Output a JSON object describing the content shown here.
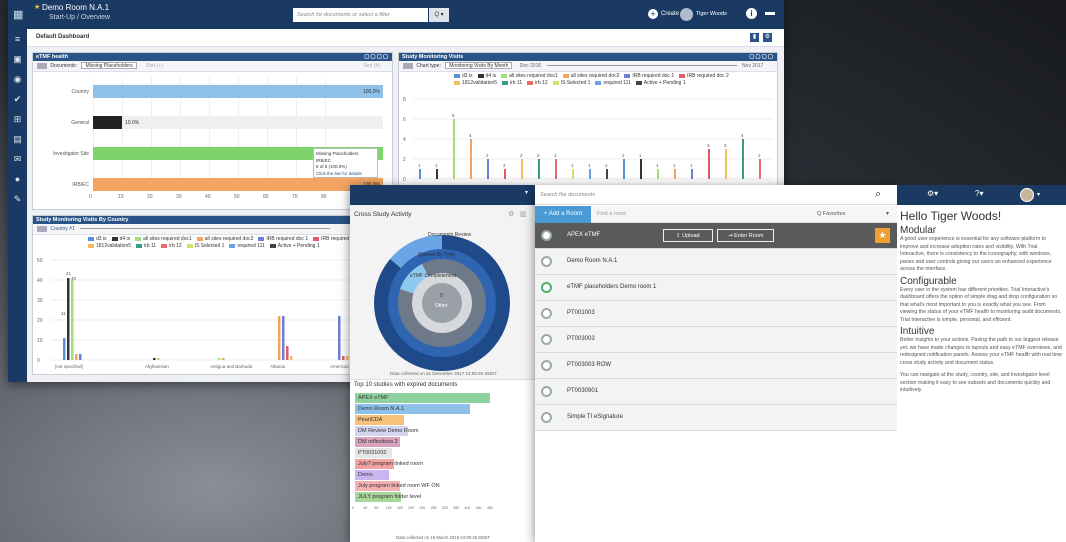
{
  "w1": {
    "app": {
      "room_title": "Demo Room N.A.1",
      "subtitle": "Start-Up / Overview",
      "search_placeholder": "Search for documents or select a filter",
      "create_label": "Create",
      "user_label": "Tiger Woods"
    },
    "dashboard_title": "Default Dashboard",
    "etmf": {
      "title": "eTMF health",
      "doc_label": "Documents:",
      "doc_value": "Missing Placeholders",
      "sort_label": "Sort (+)",
      "sort_right": "Sort (#)",
      "chart_data": {
        "type": "bar",
        "orientation": "horizontal",
        "categories": [
          "Country",
          "General",
          "Investigator Site",
          "IRB/EC"
        ],
        "values": [
          100,
          10,
          100,
          100
        ],
        "value_labels": [
          "100.0%",
          "10.0%",
          "99.7%",
          "100.0%"
        ],
        "xlim": [
          0,
          100
        ],
        "xticks": [
          0,
          10,
          20,
          30,
          40,
          50,
          60,
          70,
          80
        ],
        "colors": [
          "#8ec1ea",
          "#222222",
          "#7ed46c",
          "#f4a460"
        ]
      },
      "tooltip": {
        "l1": "Missing Placeholders",
        "l2": "IRB/EC",
        "l3": "5 of 5 (100.0%)",
        "l4": "Click the bar for details"
      }
    },
    "smv": {
      "title": "Study Monitoring Visits",
      "chart_type_label": "Chart type:",
      "chart_type_value": "Monitoring Visits By Month",
      "from": "Dec 2016",
      "to": "Nov 2017",
      "legend": [
        {
          "name": "d3 is",
          "color": "#5b8fd6"
        },
        {
          "name": "d4 is",
          "color": "#333333"
        },
        {
          "name": "all sites required doc1",
          "color": "#9be07c"
        },
        {
          "name": "all sites required doc2",
          "color": "#f4a460"
        },
        {
          "name": "IRB required doc 1",
          "color": "#6a7fd6"
        },
        {
          "name": "IRB required doc 2",
          "color": "#e05a6a"
        },
        {
          "name": "1812validation5",
          "color": "#f0c060"
        },
        {
          "name": "irb 11",
          "color": "#3a9a8a"
        },
        {
          "name": "irb 12",
          "color": "#e86a6a"
        },
        {
          "name": "IS Selected 1",
          "color": "#c7e86a"
        },
        {
          "name": "required 111",
          "color": "#6aa0e8"
        },
        {
          "name": "Active + Pending 1",
          "color": "#444444"
        }
      ],
      "chart_data": {
        "type": "bar",
        "yticks": [
          0,
          2,
          4,
          6,
          8
        ],
        "ylim": [
          0,
          8
        ],
        "labels": [
          "1",
          "1",
          "6",
          "4",
          "2",
          "2",
          "2",
          "2",
          "1",
          "1",
          "1",
          "2",
          "2",
          "1",
          "1",
          "1",
          "1",
          "3",
          "3",
          "4",
          "2"
        ]
      }
    },
    "bycountry": {
      "title": "Study Monitoring Visits By Country",
      "country_label": "Country #1",
      "chart_data": {
        "type": "bar",
        "yticks": [
          0,
          10,
          20,
          30,
          40,
          50
        ],
        "ylim": [
          0,
          50
        ],
        "categories": [
          "[not specified]",
          "Afghanistan",
          "Antigua and Barbuda",
          "Albania",
          "American Samoa"
        ],
        "labels": [
          "11",
          "41",
          "40",
          "3",
          "3",
          "1",
          "1",
          "22",
          "22",
          "7",
          "22",
          "2",
          "2"
        ]
      }
    }
  },
  "w2": {
    "title": "Cross Study Activity",
    "donut_labels": {
      "a": "Documents Review",
      "b": "Queries By Type",
      "c": "eTMF Completeness",
      "center_num": "9",
      "center": "Other"
    },
    "date_note": "Data collected on 31 December 2017 14:59:26 SMST",
    "top_title": "Top 10 studies with expired documents",
    "chart_data": {
      "type": "bar",
      "orientation": "horizontal",
      "categories": [
        "APEX eTMF",
        "Demo Room N.A.1",
        "PearlCDA",
        "DM Review Demo Room",
        "DM reflections 2",
        "PT0031002",
        "July7 program linked room",
        "Demo",
        "July program linked room WF ON",
        "JULY program folder level"
      ],
      "values": [
        480,
        410,
        175,
        190,
        160,
        130,
        140,
        120,
        160,
        165
      ],
      "xticks": [
        0,
        40,
        80,
        120,
        160,
        200,
        240,
        280,
        320,
        360,
        400,
        440,
        480
      ],
      "xlim": [
        0,
        480
      ]
    },
    "bottom_note": "Data collected on 15 March 2018 04:09:48 SMST"
  },
  "w3": {
    "search_placeholder": "Search the documents",
    "add_room": "+ Add a Room",
    "find_placeholder": "Find a room",
    "favorites": "Q Favorites",
    "upload": "Upload",
    "enter_room": "Enter Room",
    "rooms": [
      "APEX eTMF",
      "Demo Room N.A.1",
      "eTMF placeholders Demo room 1",
      "PT001003",
      "PT003003",
      "PT003003 ROW",
      "PT0030901",
      "Simple TI eSignature"
    ]
  },
  "w4": {
    "greeting": "Hello Tiger Woods!",
    "s1_title": "Modular",
    "s1_text": "A good user experience is essential for any software platform to improve and increase adoption rates and visibility. With Trial Interactive, there is consistency to the iconography, with windows, panes and user controls giving our users an enhanced experience across the interface.",
    "s2_title": "Configurable",
    "s2_text": "Every user in the system has different priorities. Trial Interactive's dashboard offers the option of simple drag and drop configuration so that what's most important to you is exactly what you see. From viewing the status of your eTMF health to monitoring audit documents, Trial Interactive is simple, personal, and efficient.",
    "s3_title": "Intuitive",
    "s3_text": "Better Insights to your actions. Paving the path to our biggest release yet, we have made changes to layouts and easy eTMF overviews, and redesigned notification panels. Assess your eTMF health with real time cross study activity and document status.",
    "s4_text": "You can navigate at the study, country, site, and investigator level section making it easy to see subsets and documents quickly and intuitively."
  }
}
